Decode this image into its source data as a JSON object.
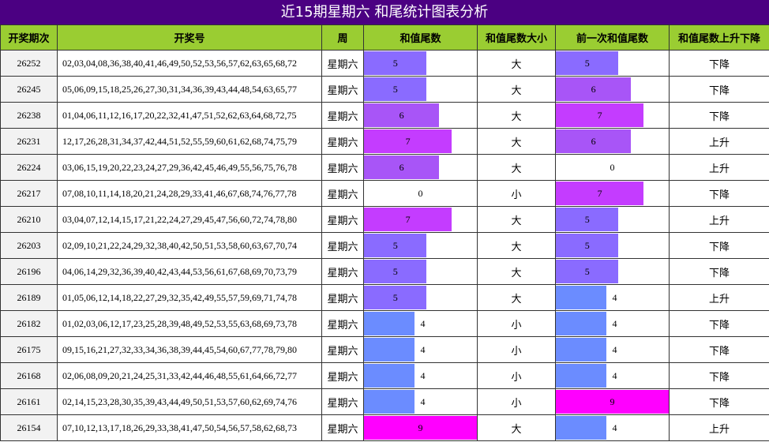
{
  "title": "近15期星期六 和尾统计图表分析",
  "colors": {
    "title_bg": "#4b0082",
    "header_bg": "#9acd32",
    "bar_colors": {
      "0": "#ffffff",
      "4": "#6b8cff",
      "5": "#8a6bff",
      "6": "#a855f7",
      "7": "#c43cff",
      "9": "#ff00ff"
    }
  },
  "headers": [
    "开奖期次",
    "开奖号",
    "周",
    "和值尾数",
    "和值尾数大小",
    "前一次和值尾数",
    "和值尾数上升下降"
  ],
  "chart_data": {
    "type": "table",
    "bar_max": 9,
    "rows": [
      {
        "period": "26252",
        "numbers": "02,03,04,08,36,38,40,41,46,49,50,52,53,56,57,62,63,65,68,72",
        "week": "星期六",
        "tail": 5,
        "size": "大",
        "prev_tail": 5,
        "trend": "下降"
      },
      {
        "period": "26245",
        "numbers": "05,06,09,15,18,25,26,27,30,31,34,36,39,43,44,48,54,63,65,77",
        "week": "星期六",
        "tail": 5,
        "size": "大",
        "prev_tail": 6,
        "trend": "下降"
      },
      {
        "period": "26238",
        "numbers": "01,04,06,11,12,16,17,20,22,32,41,47,51,52,62,63,64,68,72,75",
        "week": "星期六",
        "tail": 6,
        "size": "大",
        "prev_tail": 7,
        "trend": "下降"
      },
      {
        "period": "26231",
        "numbers": "12,17,26,28,31,34,37,42,44,51,52,55,59,60,61,62,68,74,75,79",
        "week": "星期六",
        "tail": 7,
        "size": "大",
        "prev_tail": 6,
        "trend": "上升"
      },
      {
        "period": "26224",
        "numbers": "03,06,15,19,20,22,23,24,27,29,36,42,45,46,49,55,56,75,76,78",
        "week": "星期六",
        "tail": 6,
        "size": "大",
        "prev_tail": 0,
        "trend": "上升"
      },
      {
        "period": "26217",
        "numbers": "07,08,10,11,14,18,20,21,24,28,29,33,41,46,67,68,74,76,77,78",
        "week": "星期六",
        "tail": 0,
        "size": "小",
        "prev_tail": 7,
        "trend": "下降"
      },
      {
        "period": "26210",
        "numbers": "03,04,07,12,14,15,17,21,22,24,27,29,45,47,56,60,72,74,78,80",
        "week": "星期六",
        "tail": 7,
        "size": "大",
        "prev_tail": 5,
        "trend": "上升"
      },
      {
        "period": "26203",
        "numbers": "02,09,10,21,22,24,29,32,38,40,42,50,51,53,58,60,63,67,70,74",
        "week": "星期六",
        "tail": 5,
        "size": "大",
        "prev_tail": 5,
        "trend": "下降"
      },
      {
        "period": "26196",
        "numbers": "04,06,14,29,32,36,39,40,42,43,44,53,56,61,67,68,69,70,73,79",
        "week": "星期六",
        "tail": 5,
        "size": "大",
        "prev_tail": 5,
        "trend": "下降"
      },
      {
        "period": "26189",
        "numbers": "01,05,06,12,14,18,22,27,29,32,35,42,49,55,57,59,69,71,74,78",
        "week": "星期六",
        "tail": 5,
        "size": "大",
        "prev_tail": 4,
        "trend": "上升"
      },
      {
        "period": "26182",
        "numbers": "01,02,03,06,12,17,23,25,28,39,48,49,52,53,55,63,68,69,73,78",
        "week": "星期六",
        "tail": 4,
        "size": "小",
        "prev_tail": 4,
        "trend": "下降"
      },
      {
        "period": "26175",
        "numbers": "09,15,16,21,27,32,33,34,36,38,39,44,45,54,60,67,77,78,79,80",
        "week": "星期六",
        "tail": 4,
        "size": "小",
        "prev_tail": 4,
        "trend": "下降"
      },
      {
        "period": "26168",
        "numbers": "02,06,08,09,20,21,24,25,31,33,42,44,46,48,55,61,64,66,72,77",
        "week": "星期六",
        "tail": 4,
        "size": "小",
        "prev_tail": 4,
        "trend": "下降"
      },
      {
        "period": "26161",
        "numbers": "02,14,15,23,28,30,35,39,43,44,49,50,51,53,57,60,62,69,74,76",
        "week": "星期六",
        "tail": 4,
        "size": "小",
        "prev_tail": 9,
        "trend": "下降"
      },
      {
        "period": "26154",
        "numbers": "07,10,12,13,17,18,26,29,33,38,41,47,50,54,56,57,58,62,68,73",
        "week": "星期六",
        "tail": 9,
        "size": "大",
        "prev_tail": 4,
        "trend": "上升"
      }
    ]
  }
}
